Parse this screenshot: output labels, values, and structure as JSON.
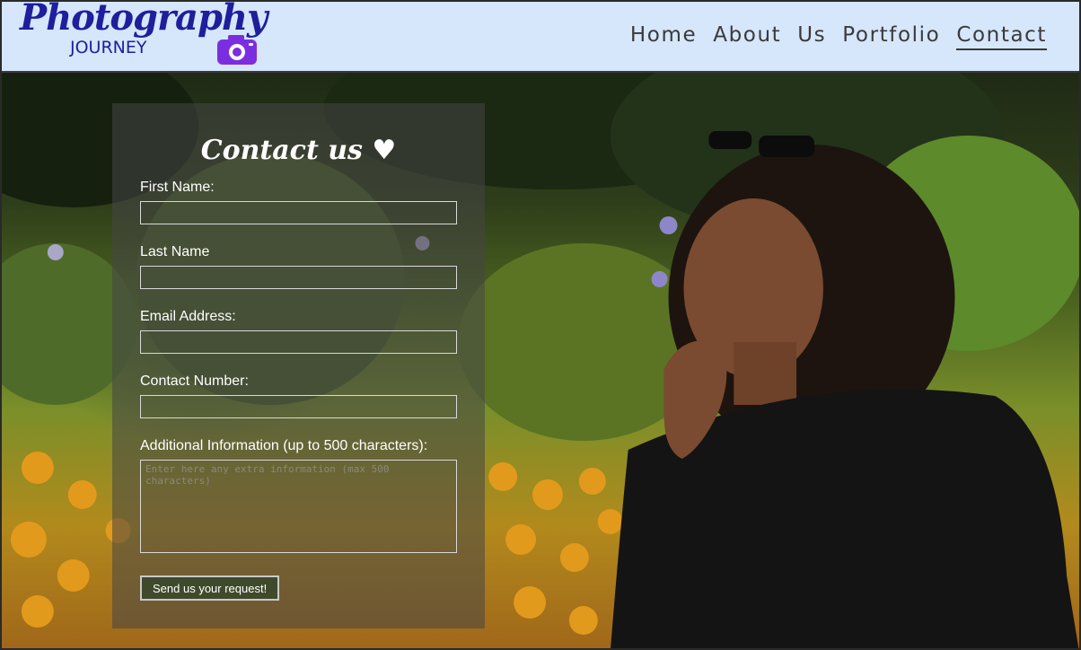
{
  "brand": {
    "title": "Photography",
    "subtitle": "JOURNEY"
  },
  "nav": {
    "items": [
      {
        "label": "Home"
      },
      {
        "label": "About"
      },
      {
        "label": "Us"
      },
      {
        "label": "Portfolio"
      },
      {
        "label": "Contact",
        "active": true
      }
    ]
  },
  "form": {
    "title": "Contact us ♥",
    "first_name_label": "First Name:",
    "first_name_value": "",
    "last_name_label": "Last Name",
    "last_name_value": "",
    "email_label": "Email Address:",
    "email_value": "",
    "phone_label": "Contact Number:",
    "phone_value": "",
    "info_label": "Additional Information (up to 500 characters):",
    "info_placeholder": "Enter here any extra information (max 500 characters)",
    "submit_label": "Send us your request!"
  },
  "colors": {
    "header_bg": "#d6e6fb",
    "brand_blue": "#1d1f9c",
    "camera_purple": "#7b2ee0",
    "nav_text": "#3a3a3a"
  },
  "icons": [
    "camera-icon",
    "heart-icon"
  ]
}
